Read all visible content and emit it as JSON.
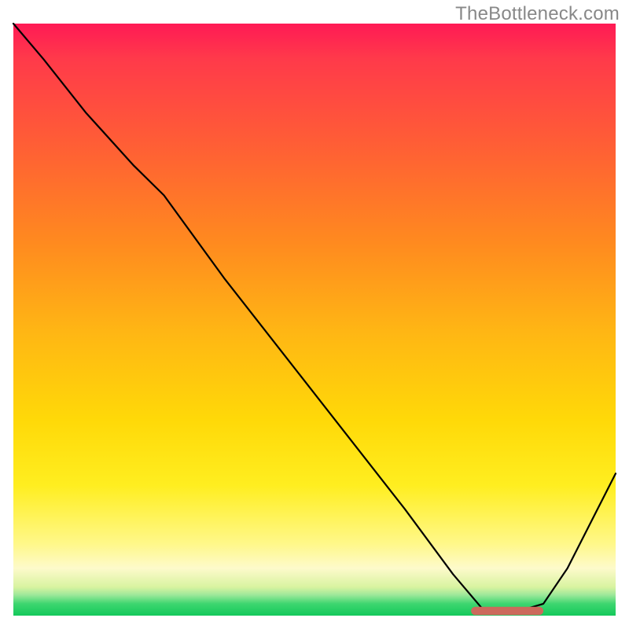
{
  "watermark": "TheBottleneck.com",
  "chart_data": {
    "type": "line",
    "title": "",
    "xlabel": "",
    "ylabel": "",
    "xlim": [
      0,
      100
    ],
    "ylim": [
      0,
      100
    ],
    "background_gradient": {
      "direction": "vertical",
      "stops": [
        {
          "pos": 0,
          "color": "#ff1a55"
        },
        {
          "pos": 0.22,
          "color": "#ff6233"
        },
        {
          "pos": 0.52,
          "color": "#ffb614"
        },
        {
          "pos": 0.78,
          "color": "#ffee20"
        },
        {
          "pos": 0.92,
          "color": "#fdfacb"
        },
        {
          "pos": 1.0,
          "color": "#14c95b"
        }
      ]
    },
    "series": [
      {
        "name": "bottleneck-curve",
        "color": "#000000",
        "x": [
          0,
          5,
          12,
          20,
          25,
          35,
          45,
          55,
          65,
          73,
          78,
          83,
          88,
          92,
          100
        ],
        "y": [
          100,
          94,
          85,
          76,
          71,
          57,
          44,
          31,
          18,
          7,
          1,
          0.5,
          2,
          8,
          24
        ]
      }
    ],
    "marker": {
      "name": "optimal-zone",
      "shape": "rounded-bar",
      "color": "#cc6a5c",
      "x_start": 76,
      "x_end": 88,
      "y": 0.8,
      "height": 1.4
    }
  }
}
